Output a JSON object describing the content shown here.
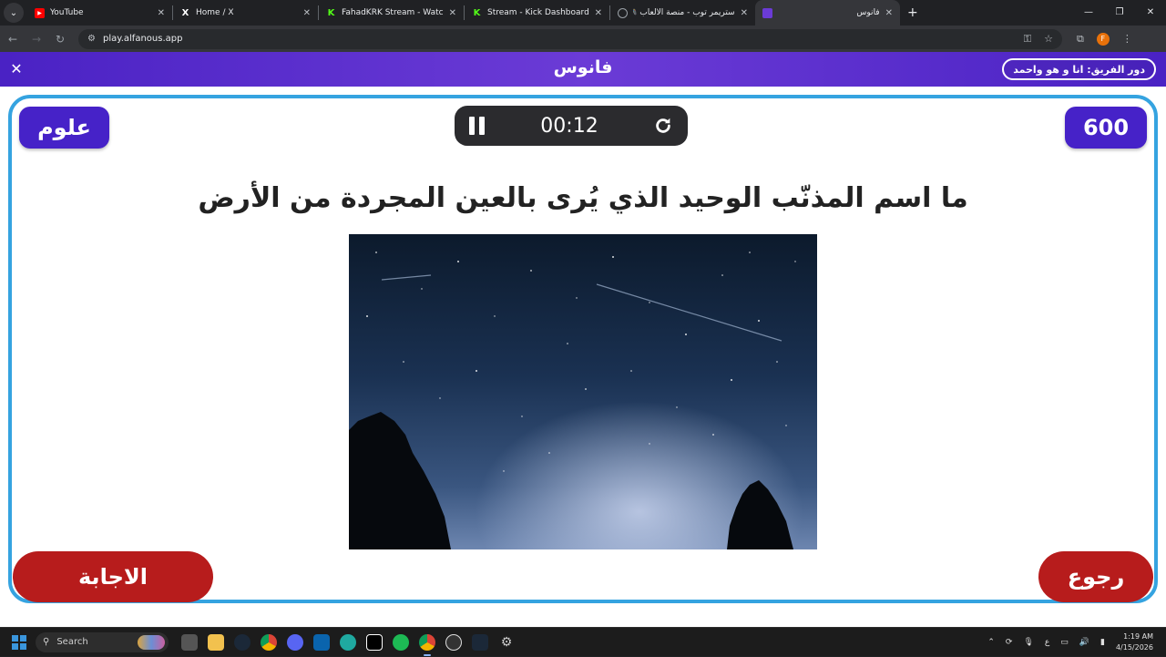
{
  "browser": {
    "tabs": [
      {
        "title": "YouTube",
        "favicon": "youtube-icon",
        "color": "#ff0000"
      },
      {
        "title": "Home / X",
        "favicon": "x-icon",
        "color": "#000000"
      },
      {
        "title": "FahadKRK Stream - Watch Live",
        "favicon": "kick-icon",
        "color": "#53fc18"
      },
      {
        "title": "Stream - Kick Dashboard",
        "favicon": "kick-icon",
        "color": "#53fc18"
      },
      {
        "title": "ستريمر توب - منصة الألعاب 🎮",
        "favicon": "globe-icon",
        "color": "#9aa0a6"
      },
      {
        "title": "فانوس",
        "favicon": "alfanous-icon",
        "color": "#6b3bd6"
      }
    ],
    "url": "play.alfanous.app"
  },
  "game": {
    "logo": "فانوس",
    "turn_label": "دور الفريق: انا و هو واحمد",
    "category": "علوم",
    "points": "600",
    "timer": "00:12",
    "question": "ما اسم المذنّب الوحيد الذي يُرى بالعين المجردة من الأرض",
    "answer_button": "الاجابة",
    "back_button": "رجوع",
    "colors": {
      "header": "#4a22c4",
      "frame": "#35a3e0",
      "badge": "#4622c8",
      "action": "#b71c1c"
    }
  },
  "taskbar": {
    "search_placeholder": "Search",
    "time": "1:19 AM",
    "date": "4/15/2026",
    "lang": "ع"
  }
}
